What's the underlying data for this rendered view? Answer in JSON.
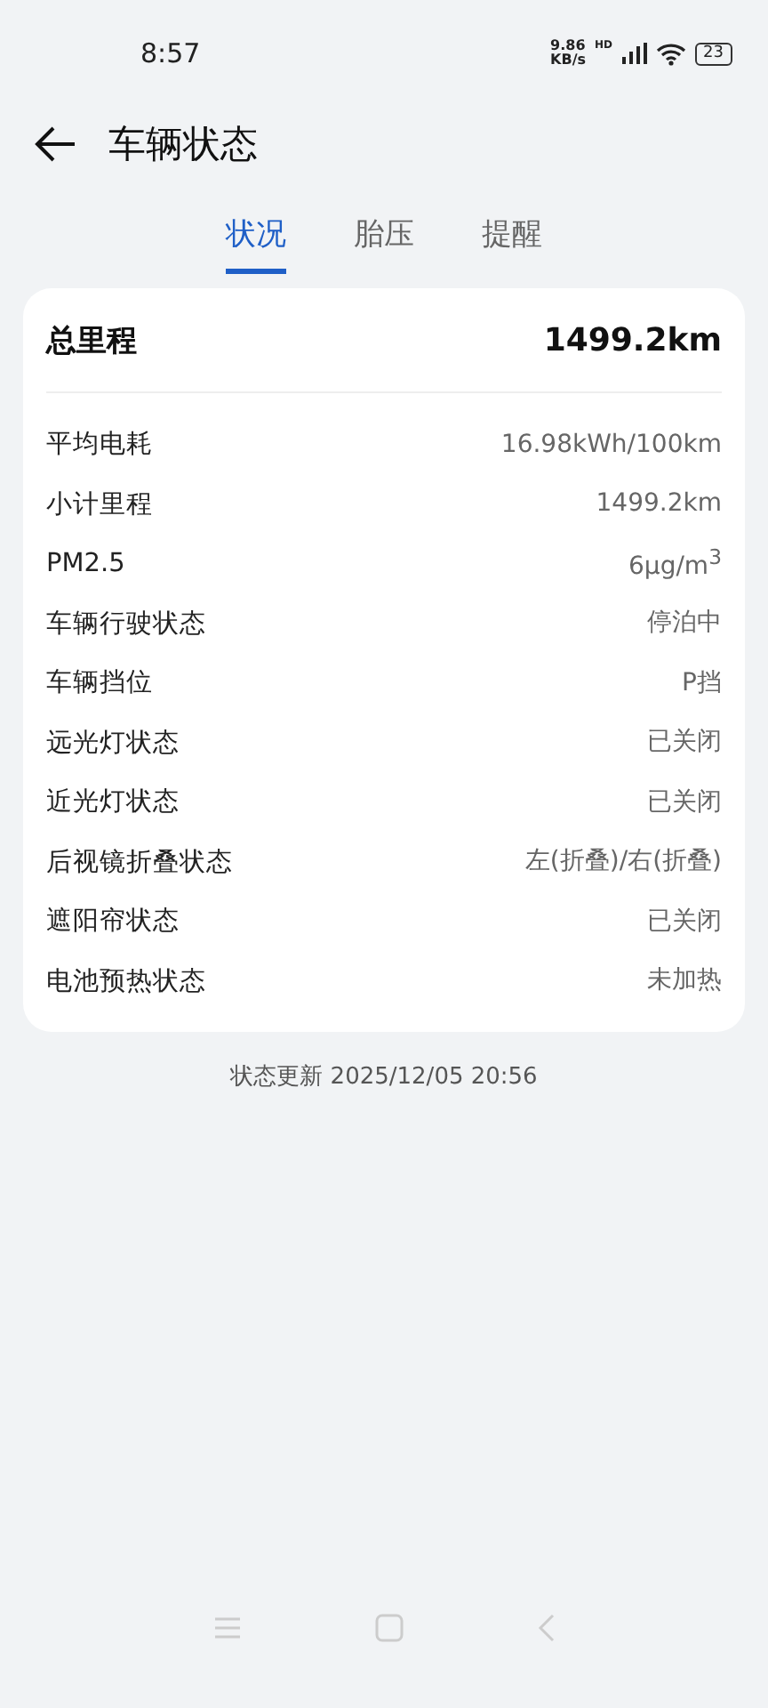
{
  "status_bar": {
    "time": "8:57",
    "speed": "9.86",
    "speed_unit": "KB/s",
    "network": "HD",
    "battery": "23"
  },
  "header": {
    "title": "车辆状态"
  },
  "tabs": [
    {
      "label": "状况",
      "selected": true
    },
    {
      "label": "胎压",
      "selected": false
    },
    {
      "label": "提醒",
      "selected": false
    }
  ],
  "card": {
    "total": {
      "label": "总里程",
      "value": "1499.2km"
    },
    "rows": [
      {
        "label": "平均电耗",
        "value": "16.98kWh/100km"
      },
      {
        "label": "小计里程",
        "value": "1499.2km"
      },
      {
        "label": "PM2.5",
        "value": "6μg/m$^{3}$"
      },
      {
        "label": "车辆行驶状态",
        "value": "停泊中"
      },
      {
        "label": "车辆挡位",
        "value": "P挡"
      },
      {
        "label": "远光灯状态",
        "value": "已关闭"
      },
      {
        "label": "近光灯状态",
        "value": "已关闭"
      },
      {
        "label": "后视镜折叠状态",
        "value": "左(折叠)/右(折叠)"
      },
      {
        "label": "遮阳帘状态",
        "value": "已关闭"
      },
      {
        "label": "电池预热状态",
        "value": "未加热"
      }
    ]
  },
  "update_note": "状态更新 2025/12/05 20:56"
}
